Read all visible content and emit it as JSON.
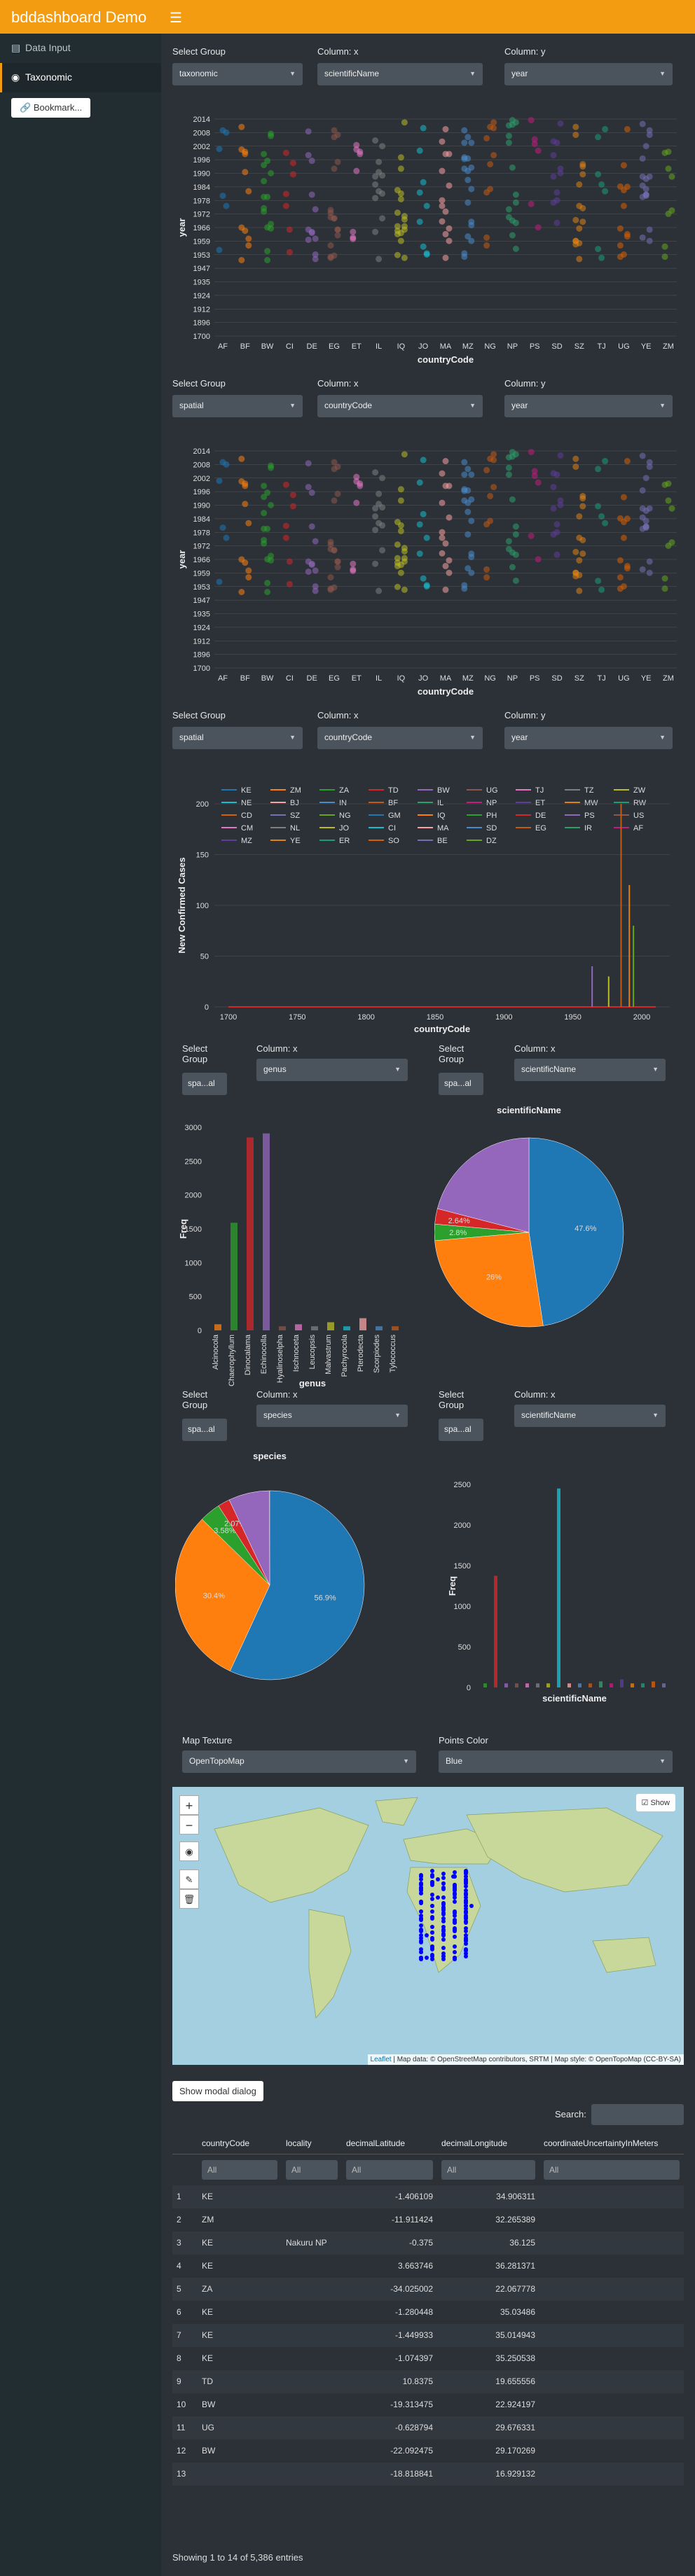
{
  "app": {
    "title": "bddashboard Demo",
    "menu_icon": "hamburger-icon"
  },
  "sidebar": {
    "items": [
      {
        "label": "Data Input",
        "icon": "file-icon"
      },
      {
        "label": "Taxonomic",
        "icon": "eye-icon"
      }
    ],
    "bookmark_label": "Bookmark..."
  },
  "controls": {
    "s1": {
      "group_label": "Select Group",
      "group_value": "taxonomic",
      "x_label": "Column: x",
      "x_value": "scientificName",
      "y_label": "Column: y",
      "y_value": "year"
    },
    "s2": {
      "group_label": "Select Group",
      "group_value": "spatial",
      "x_label": "Column: x",
      "x_value": "countryCode",
      "y_label": "Column: y",
      "y_value": "year"
    },
    "s3": {
      "group_label": "Select Group",
      "group_value": "spatial",
      "x_label": "Column: x",
      "x_value": "countryCode",
      "y_label": "Column: y",
      "y_value": "year"
    },
    "s4": {
      "group_label_a": "Select",
      "group_label_b": "Group",
      "group_value": "spa...al",
      "x_label": "Column: x",
      "x_value": "genus",
      "group2_label_a": "Select",
      "group2_label_b": "Group",
      "group2_value": "spa...al",
      "x2_label": "Column: x",
      "x2_value": "scientificName"
    },
    "s5": {
      "group_label_a": "Select",
      "group_label_b": "Group",
      "group_value": "spa...al",
      "x_label": "Column: x",
      "x_value": "species",
      "group2_label_a": "Select",
      "group2_label_b": "Group",
      "group2_value": "spa...al",
      "x2_label": "Column: x",
      "x2_value": "scientificName"
    },
    "map": {
      "texture_label": "Map Texture",
      "texture_value": "OpenTopoMap",
      "color_label": "Points Color",
      "color_value": "Blue"
    }
  },
  "chart_data": [
    {
      "type": "scatter",
      "xlabel": "countryCode",
      "ylabel": "year",
      "categories": [
        "AF",
        "BF",
        "BW",
        "CI",
        "DE",
        "EG",
        "ET",
        "IL",
        "IQ",
        "JO",
        "MA",
        "MZ",
        "NG",
        "NP",
        "PS",
        "SD",
        "SZ",
        "TJ",
        "UG",
        "YE",
        "ZM"
      ],
      "y_ticks": [
        "1700",
        "1896",
        "1912",
        "1924",
        "1935",
        "1947",
        "1953",
        "1959",
        "1966",
        "1972",
        "1978",
        "1984",
        "1990",
        "1996",
        "2002",
        "2008",
        "2014"
      ]
    },
    {
      "type": "scatter",
      "xlabel": "countryCode",
      "ylabel": "year",
      "categories": [
        "AF",
        "BF",
        "BW",
        "CI",
        "DE",
        "EG",
        "ET",
        "IL",
        "IQ",
        "JO",
        "MA",
        "MZ",
        "NG",
        "NP",
        "PS",
        "SD",
        "SZ",
        "TJ",
        "UG",
        "YE",
        "ZM"
      ],
      "y_ticks": [
        "1700",
        "1896",
        "1912",
        "1924",
        "1935",
        "1947",
        "1953",
        "1959",
        "1966",
        "1972",
        "1978",
        "1984",
        "1990",
        "1996",
        "2002",
        "2008",
        "2014"
      ]
    },
    {
      "type": "line",
      "xlabel": "countryCode",
      "ylabel": "New Confirmed Cases",
      "x_ticks": [
        "1700",
        "1750",
        "1800",
        "1850",
        "1900",
        "1950",
        "2000"
      ],
      "y_ticks": [
        "0",
        "50",
        "100",
        "150",
        "200"
      ],
      "legend": [
        "KE",
        "ZM",
        "ZA",
        "TD",
        "BW",
        "UG",
        "TJ",
        "TZ",
        "ZW",
        "NE",
        "BJ",
        "IN",
        "BF",
        "IL",
        "NP",
        "ET",
        "MW",
        "RW",
        "CD",
        "SZ",
        "NG",
        "GM",
        "IQ",
        "PH",
        "DE",
        "PS",
        "US",
        "CM",
        "NL",
        "JO",
        "CI",
        "MA",
        "SD",
        "EG",
        "IR",
        "AF",
        "MZ",
        "YE",
        "ER",
        "SO",
        "BE",
        "DZ"
      ]
    },
    {
      "type": "bar",
      "xlabel": "genus",
      "ylabel": "Freq",
      "y_ticks": [
        "0",
        "250",
        "500",
        "750",
        "1000",
        "1500",
        "2000",
        "2500",
        "3000"
      ],
      "categories": [
        "Alcinocola",
        "Chaerophyllum",
        "Dinocalama",
        "Echinocolla",
        "Hyalinoselpha",
        "Ischnoceta",
        "Leucopsis",
        "Malvastrum",
        "Pachyrocola",
        "Pterodecta",
        "Scorpiodes",
        "Tylococcus"
      ]
    },
    {
      "type": "pie",
      "title": "scientificName",
      "labels": [
        "47.6%",
        "26%",
        "2.8%",
        "2.64%"
      ]
    },
    {
      "type": "pie",
      "title": "species",
      "labels": [
        "56.9%",
        "30.4%",
        "3.58%",
        "2.07%"
      ]
    },
    {
      "type": "bar",
      "xlabel": "scientificName",
      "ylabel": "Freq",
      "y_ticks": [
        "0",
        "500",
        "1000",
        "1500",
        "2000",
        "2500"
      ]
    }
  ],
  "map": {
    "attribution_leaflet": "Leaflet",
    "attribution_rest": " | Map data: © OpenStreetMap contributors, SRTM | Map style: © OpenTopoMap (CC-BY-SA)",
    "legend_label": "Show"
  },
  "table": {
    "modal_button": "Show modal dialog",
    "search_label": "Search:",
    "columns": [
      "countryCode",
      "locality",
      "decimalLatitude",
      "decimalLongitude",
      "coordinateUncertaintyInMeters"
    ],
    "filter_placeholder": "All",
    "rows": [
      [
        "1",
        "KE",
        "",
        "-1.406109",
        "34.906311"
      ],
      [
        "2",
        "ZM",
        "",
        "-11.911424",
        "32.265389"
      ],
      [
        "3",
        "KE",
        "Nakuru NP",
        "-0.375",
        "36.125"
      ],
      [
        "4",
        "KE",
        "",
        "3.663746",
        "36.281371"
      ],
      [
        "5",
        "ZA",
        "",
        "-34.025002",
        "22.067778"
      ],
      [
        "6",
        "KE",
        "",
        "-1.280448",
        "35.03486"
      ],
      [
        "7",
        "KE",
        "",
        "-1.449933",
        "35.014943"
      ],
      [
        "8",
        "KE",
        "",
        "-1.074397",
        "35.250538"
      ],
      [
        "9",
        "TD",
        "",
        "10.8375",
        "19.655556"
      ],
      [
        "10",
        "BW",
        "",
        "-19.313475",
        "22.924197"
      ],
      [
        "11",
        "UG",
        "",
        "-0.628794",
        "29.676331"
      ],
      [
        "12",
        "BW",
        "",
        "-22.092475",
        "29.170269"
      ],
      [
        "13",
        "",
        "",
        "-18.818841",
        "16.929132"
      ]
    ],
    "footer": "Showing 1 to 14 of 5,386 entries"
  }
}
